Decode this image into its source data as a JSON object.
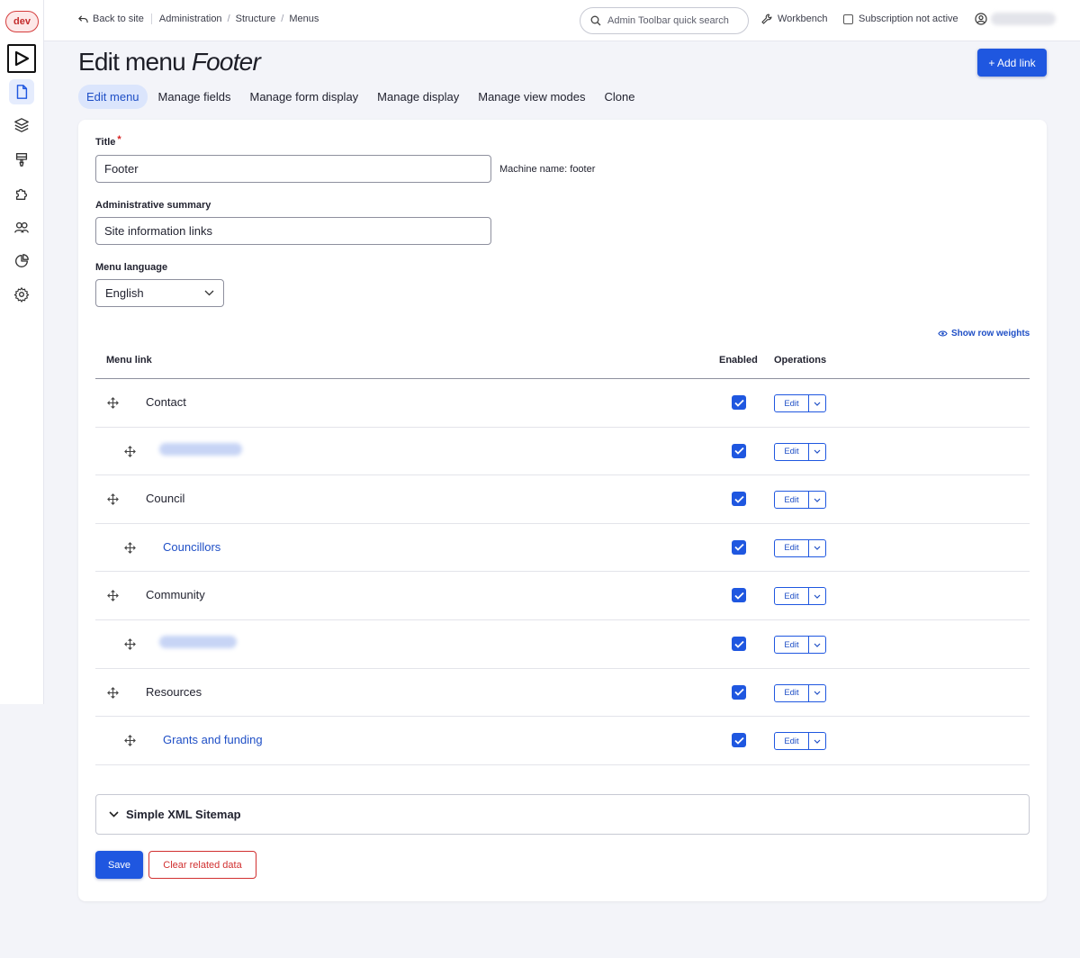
{
  "env": {
    "badge": "dev"
  },
  "topbar": {
    "breadcrumbs": {
      "back": "Back to site",
      "items": [
        "Administration",
        "Structure",
        "Menus"
      ]
    },
    "search_placeholder": "Admin Toolbar quick search",
    "workbench": "Workbench",
    "subscription": "Subscription not active"
  },
  "page": {
    "title_prefix": "Edit menu",
    "title_name": "Footer",
    "add_link": "+ Add link",
    "tabs": [
      "Edit menu",
      "Manage fields",
      "Manage form display",
      "Manage display",
      "Manage view modes",
      "Clone"
    ]
  },
  "form": {
    "title_label": "Title",
    "required_mark": "*",
    "title_value": "Footer",
    "machine_name": "Machine name: footer",
    "summary_label": "Administrative summary",
    "summary_value": "Site information links",
    "language_label": "Menu language",
    "language_value": "English"
  },
  "table": {
    "show_weights": "Show row weights",
    "headers": {
      "link": "Menu link",
      "enabled": "Enabled",
      "operations": "Operations"
    },
    "edit_label": "Edit",
    "rows": [
      {
        "text": "Contact",
        "child": false,
        "enabled": true
      },
      {
        "text": "",
        "child": true,
        "enabled": true
      },
      {
        "text": "Council",
        "child": false,
        "enabled": true
      },
      {
        "text": "Councillors",
        "child": true,
        "enabled": true
      },
      {
        "text": "Community",
        "child": false,
        "enabled": true
      },
      {
        "text": "",
        "child": true,
        "enabled": true
      },
      {
        "text": "Resources",
        "child": false,
        "enabled": true
      },
      {
        "text": "Grants and funding",
        "child": true,
        "enabled": true
      }
    ]
  },
  "sitemap": {
    "label": "Simple XML Sitemap"
  },
  "actions": {
    "save": "Save",
    "clear": "Clear related data"
  },
  "colors": {
    "accent": "#1f57e0",
    "danger": "#d13030"
  }
}
